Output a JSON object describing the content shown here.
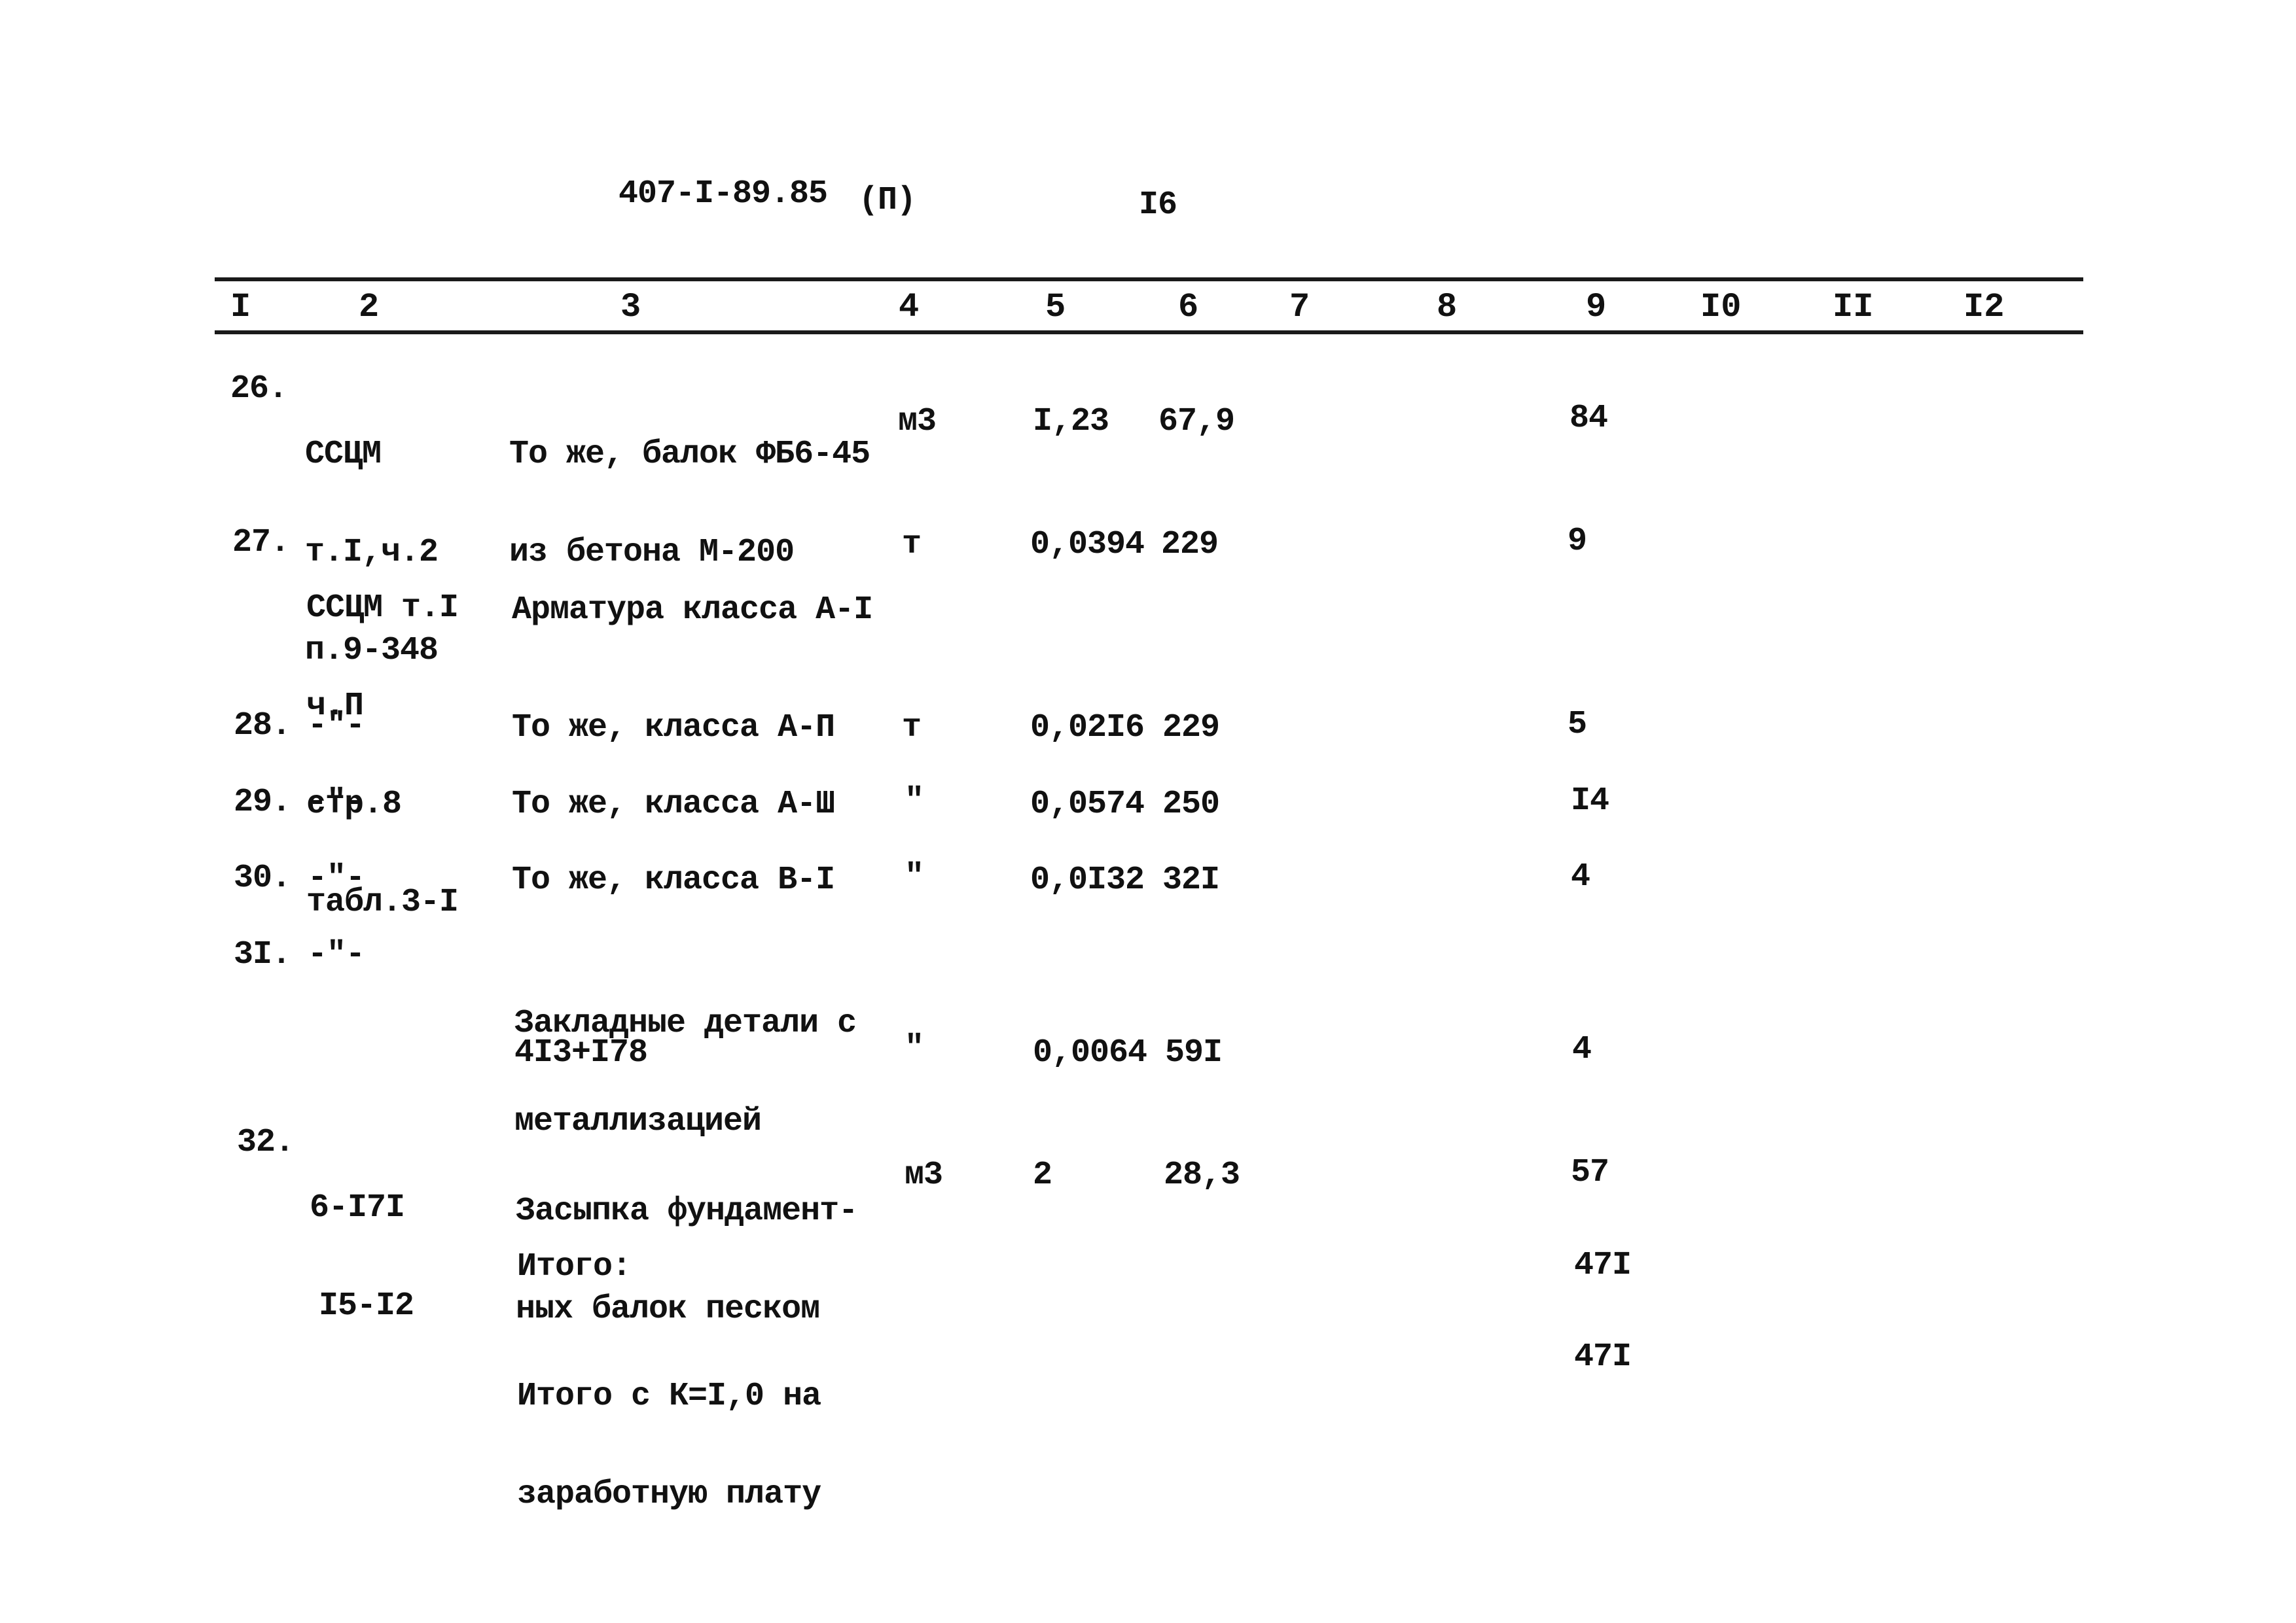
{
  "header": {
    "doc_code": "407-I-89.85",
    "part": "(П)",
    "page": "I6"
  },
  "columns": [
    "I",
    "2",
    "3",
    "4",
    "5",
    "6",
    "7",
    "8",
    "9",
    "I0",
    "II",
    "I2"
  ],
  "rows": [
    {
      "num": "26.",
      "ref": [
        "ССЦМ",
        "т.I,ч.2",
        "п.9-348"
      ],
      "desc": [
        "То же, балок ФБ6-45",
        "из бетона М-200"
      ],
      "unit": "м3",
      "qty": "I,23",
      "price": "67,9",
      "total": "84"
    },
    {
      "num": "27.",
      "ref": [
        "ССЦМ т.I",
        "ч.П",
        "стр.8",
        "табл.3-I"
      ],
      "desc": [
        "Арматура класса А-I"
      ],
      "unit": "т",
      "qty": "0,0394",
      "price": "229",
      "total": "9"
    },
    {
      "num": "28.",
      "ref": [
        "-\"-"
      ],
      "desc": [
        "То же, класса А-П"
      ],
      "unit": "т",
      "qty": "0,02I6",
      "price": "229",
      "total": "5"
    },
    {
      "num": "29.",
      "ref": [
        "-\"-"
      ],
      "desc": [
        "То же, класса А-Ш"
      ],
      "unit": "\"",
      "qty": "0,0574",
      "price": "250",
      "total": "I4"
    },
    {
      "num": "30.",
      "ref": [
        "-\"-"
      ],
      "desc": [
        "То же, класса В-I"
      ],
      "unit": "\"",
      "qty": "0,0I32",
      "price": "32I",
      "total": "4"
    },
    {
      "num": "3I.",
      "ref": [
        "-\"-"
      ],
      "desc": [
        "Закладные детали с",
        "металлизацией"
      ],
      "subdesc": "4I3+I78",
      "unit": "\"",
      "qty": "0,0064",
      "price": "59I",
      "total": "4"
    },
    {
      "num": "32.",
      "ref": [
        "6-I7I",
        "I5-I2"
      ],
      "desc": [
        "Засыпка фундамент-",
        "ных балок песком"
      ],
      "unit": "м3",
      "qty": "2",
      "price": "28,3",
      "total": "57"
    }
  ],
  "totals": [
    {
      "label": [
        "Итого:"
      ],
      "value": "47I"
    },
    {
      "label": [
        "Итого с К=I,0 на",
        "заработную плату"
      ],
      "value": "47I"
    }
  ]
}
